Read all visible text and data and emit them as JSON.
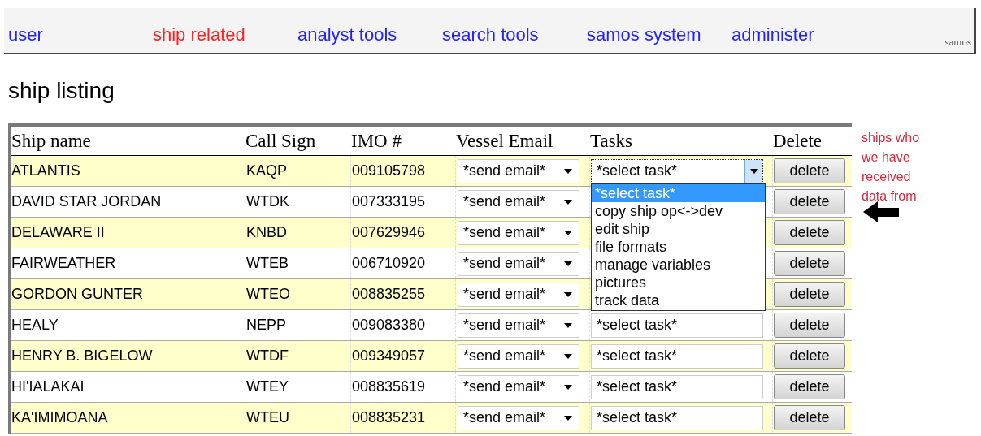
{
  "nav": {
    "items": [
      {
        "label": "user",
        "selected": false
      },
      {
        "label": "ship related",
        "selected": true
      },
      {
        "label": "analyst tools",
        "selected": false
      },
      {
        "label": "search tools",
        "selected": false
      },
      {
        "label": "samos system",
        "selected": false
      },
      {
        "label": "administer",
        "selected": false
      }
    ],
    "site": "samos"
  },
  "title": "ship listing",
  "table": {
    "columns": [
      "Ship name",
      "Call Sign",
      "IMO #",
      "Vessel Email",
      "Tasks",
      "Delete"
    ],
    "rows": [
      {
        "name": "ATLANTIS",
        "call_sign": "KAQP",
        "imo": "009105798",
        "email": "*send email*",
        "task": {
          "value": "*select task*",
          "expanded": true
        },
        "delete": "delete",
        "received": true
      },
      {
        "name": "DAVID STAR JORDAN",
        "call_sign": "WTDK",
        "imo": "007333195",
        "email": "*send email*",
        "delete": "delete",
        "received": false
      },
      {
        "name": "DELAWARE II",
        "call_sign": "KNBD",
        "imo": "007629946",
        "email": "*send email*",
        "delete": "delete",
        "received": true
      },
      {
        "name": "FAIRWEATHER",
        "call_sign": "WTEB",
        "imo": "006710920",
        "email": "*send email*",
        "delete": "delete",
        "received": false
      },
      {
        "name": "GORDON GUNTER",
        "call_sign": "WTEO",
        "imo": "008835255",
        "email": "*send email*",
        "delete": "delete",
        "received": true
      },
      {
        "name": "HEALY",
        "call_sign": "NEPP",
        "imo": "009083380",
        "email": "*send email*",
        "task": {
          "value": "*select task*",
          "expanded": false
        },
        "delete": "delete",
        "received": false
      },
      {
        "name": "HENRY B. BIGELOW",
        "call_sign": "WTDF",
        "imo": "009349057",
        "email": "*send email*",
        "task": {
          "value": "*select task*",
          "expanded": false
        },
        "delete": "delete",
        "received": true
      },
      {
        "name": "HI'IALAKAI",
        "call_sign": "WTEY",
        "imo": "008835619",
        "email": "*send email*",
        "task": {
          "value": "*select task*",
          "expanded": false
        },
        "delete": "delete",
        "received": false
      },
      {
        "name": "KA'IMIMOANA",
        "call_sign": "WTEU",
        "imo": "008835231",
        "email": "*send email*",
        "task": {
          "value": "*select task*",
          "expanded": false
        },
        "delete": "delete",
        "received": true
      }
    ]
  },
  "task_menu": {
    "options": [
      {
        "label": "*select task*",
        "selected": true
      },
      {
        "label": "copy ship op<->dev",
        "selected": false
      },
      {
        "label": "edit ship",
        "selected": false
      },
      {
        "label": "file formats",
        "selected": false
      },
      {
        "label": "manage variables",
        "selected": false
      },
      {
        "label": "pictures",
        "selected": false
      },
      {
        "label": "track data",
        "selected": false
      }
    ]
  },
  "annotation": "ships who we have received data from"
}
